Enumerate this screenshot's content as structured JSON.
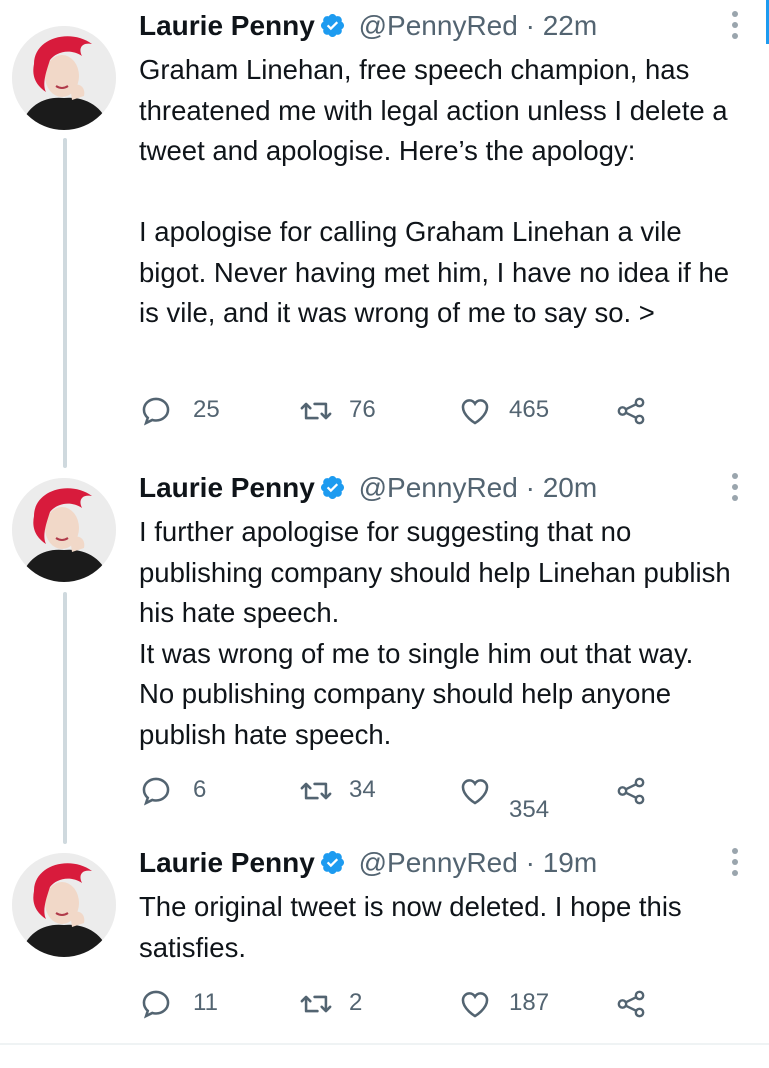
{
  "tweets": [
    {
      "name": "Laurie Penny",
      "handle": "@PennyRed",
      "separator": "·",
      "time": "22m",
      "body": [
        "Graham Linehan, free speech champion, has threatened me with legal action unless I delete a tweet and apologise. Here’s the apology:",
        "I apologise for calling Graham Linehan a vile bigot. Never having met him, I have no idea if he is vile, and it was wrong of me to say so. >"
      ],
      "replies": "25",
      "retweets": "76",
      "likes": "465"
    },
    {
      "name": "Laurie Penny",
      "handle": "@PennyRed",
      "separator": "·",
      "time": "20m",
      "body": [
        "I further apologise for suggesting that no publishing company should help Linehan publish his hate speech.",
        "It was wrong of me to single him out that way.",
        "No publishing company should help anyone publish hate speech."
      ],
      "replies": "6",
      "retweets": "34",
      "likes": "354"
    },
    {
      "name": "Laurie Penny",
      "handle": "@PennyRed",
      "separator": "·",
      "time": "19m",
      "body": [
        "The original tweet is now deleted. I hope this satisfies."
      ],
      "replies": "11",
      "retweets": "2",
      "likes": "187"
    }
  ],
  "icons": {
    "verified": "verified-badge-icon",
    "more": "more-options-icon",
    "reply": "reply-icon",
    "retweet": "retweet-icon",
    "like": "like-icon",
    "share": "share-icon"
  },
  "colors": {
    "verified": "#1d9bf0",
    "text": "#0f1419",
    "secondary": "#536471",
    "thread_line": "#cfd9de",
    "hair": "#d81b3c"
  }
}
